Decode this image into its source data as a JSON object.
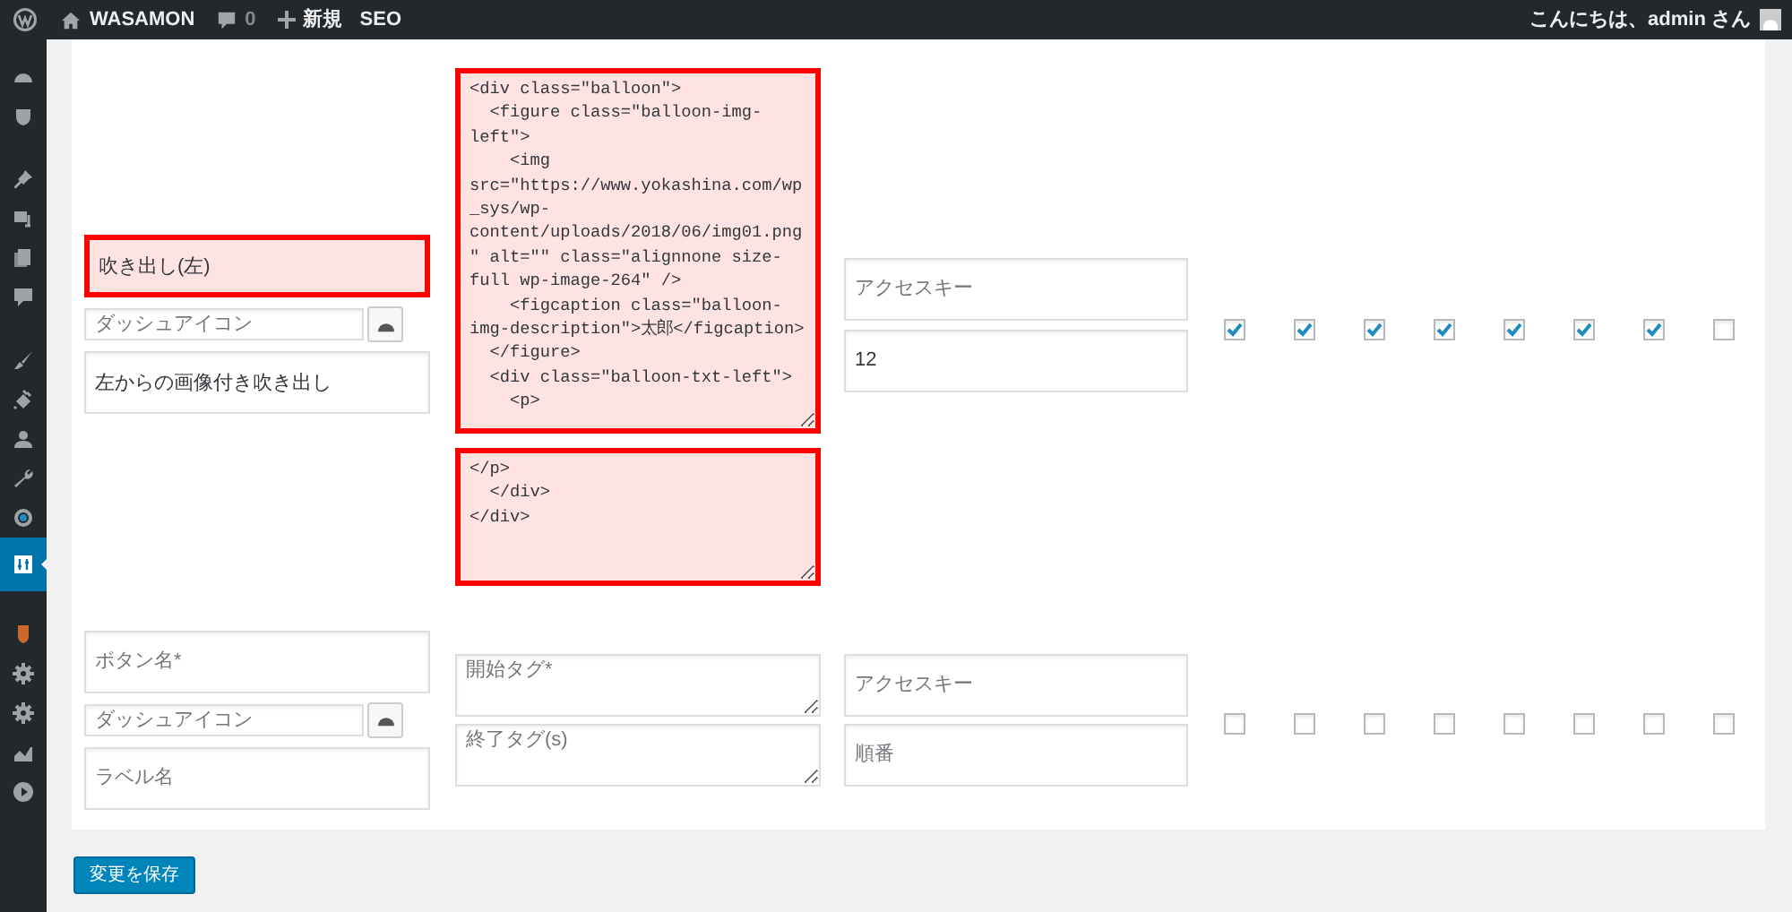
{
  "admin_bar": {
    "site_name": "WASAMON",
    "comments": "0",
    "new": "新規",
    "seo": "SEO",
    "greeting": "こんにちは、admin さん"
  },
  "sidebar": {
    "items": [
      {
        "selected": false
      },
      {
        "selected": false
      },
      {
        "selected": false
      },
      {
        "selected": false
      },
      {
        "selected": false
      },
      {
        "selected": false
      },
      {
        "selected": false
      },
      {
        "selected": false
      },
      {
        "selected": false
      },
      {
        "selected": false
      },
      {
        "selected": false
      },
      {
        "selected": true
      },
      {
        "selected": false
      },
      {
        "selected": false
      },
      {
        "selected": false
      },
      {
        "selected": false
      },
      {
        "selected": false
      }
    ]
  },
  "rows": [
    {
      "name": {
        "value": "吹き出し(左)",
        "error": true
      },
      "dashicon": {
        "placeholder": "ダッシュアイコン",
        "error": false
      },
      "label": {
        "value": "左からの画像付き吹き出し",
        "error": false
      },
      "start_tag": {
        "value": "<div class=\"balloon\">\n  <figure class=\"balloon-img-left\">\n    <img src=\"https://www.yokashina.com/wp_sys/wp-content/uploads/2018/06/img01.png\" alt=\"\" class=\"alignnone size-full wp-image-264\" />\n    <figcaption class=\"balloon-img-description\">太郎</figcaption>\n  </figure>\n  <div class=\"balloon-txt-left\">\n    <p>",
        "error": true
      },
      "end_tag": {
        "value": "</p>\n  </div>\n</div>",
        "error": true
      },
      "access_key": {
        "placeholder": "アクセスキー",
        "error": false
      },
      "order": {
        "value": "12",
        "error": false
      },
      "checks": [
        {
          "checked": true
        },
        {
          "checked": true
        },
        {
          "checked": true
        },
        {
          "checked": true
        },
        {
          "checked": true
        },
        {
          "checked": true
        },
        {
          "checked": true
        },
        {
          "checked": false
        }
      ]
    },
    {
      "name": {
        "placeholder": "ボタン名*",
        "error": false
      },
      "dashicon": {
        "placeholder": "ダッシュアイコン",
        "error": false
      },
      "label": {
        "placeholder": "ラベル名",
        "error": false
      },
      "start_tag": {
        "placeholder": "開始タグ*",
        "error": false
      },
      "end_tag": {
        "placeholder": "終了タグ(s)",
        "error": false
      },
      "access_key": {
        "placeholder": "アクセスキー",
        "error": false
      },
      "order": {
        "placeholder": "順番",
        "error": false
      },
      "checks": [
        {
          "checked": false
        },
        {
          "checked": false
        },
        {
          "checked": false
        },
        {
          "checked": false
        },
        {
          "checked": false
        },
        {
          "checked": false
        },
        {
          "checked": false
        },
        {
          "checked": false
        }
      ]
    }
  ],
  "save_button": "変更を保存"
}
